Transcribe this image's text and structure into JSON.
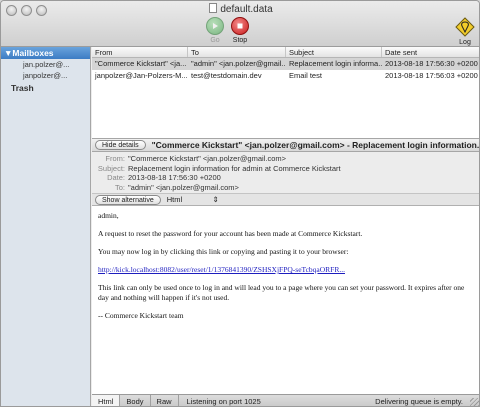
{
  "window": {
    "title": "default.data"
  },
  "toolbar": {
    "go_label": "Go",
    "stop_label": "Stop",
    "log_label": "Log"
  },
  "sidebar": {
    "header": "Mailboxes",
    "mailboxes": [
      "jan.polzer@...",
      "janpolzer@..."
    ],
    "trash": "Trash"
  },
  "list": {
    "columns": {
      "from": "From",
      "to": "To",
      "subject": "Subject",
      "date": "Date sent"
    },
    "rows": [
      {
        "from": "\"Commerce Kickstart\" <ja...",
        "to": "\"admin\" <jan.polzer@gmail...",
        "subject": "Replacement login informa...",
        "date": "2013-08-18 17:56:30 +0200"
      },
      {
        "from": "janpolzer@Jan-Polzers-M...",
        "to": "test@testdomain.dev",
        "subject": "Email test",
        "date": "2013-08-18 17:56:03 +0200"
      }
    ]
  },
  "detail": {
    "hide_details": "Hide details",
    "title": "\"Commerce Kickstart\" <jan.polzer@gmail.com> - Replacement login information...",
    "headers": {
      "from_label": "From:",
      "from": "\"Commerce Kickstart\" <jan.polzer@gmail.com>",
      "subject_label": "Subject:",
      "subject": "Replacement login information for admin at Commerce Kickstart",
      "date_label": "Date:",
      "date": "2013-08-18 17:56:30 +0200",
      "to_label": "To:",
      "to": "\"admin\" <jan.polzer@gmail.com>"
    },
    "show_alternative": "Show alternative",
    "view_select": "Html"
  },
  "body": {
    "greeting": "admin,",
    "p1": "A request to reset the password for your account has been made at Commerce Kickstart.",
    "p2": "You may now log in by clicking this link or copying and pasting it to your browser:",
    "link": "http://kick.localhost:8082/user/reset/1/1376841390/ZSHSXjFPQ-seTcbqaORFR...",
    "p3": "This link can only be used once to log in and will lead you to a page where you can set your password. It expires after one day and nothing will happen if it's not used.",
    "signoff": "-- Commerce Kickstart team"
  },
  "bottom": {
    "tabs": [
      "Html",
      "Body",
      "Raw"
    ],
    "status_left": "Listening on port 1025",
    "status_right": "Delivering queue is empty."
  }
}
